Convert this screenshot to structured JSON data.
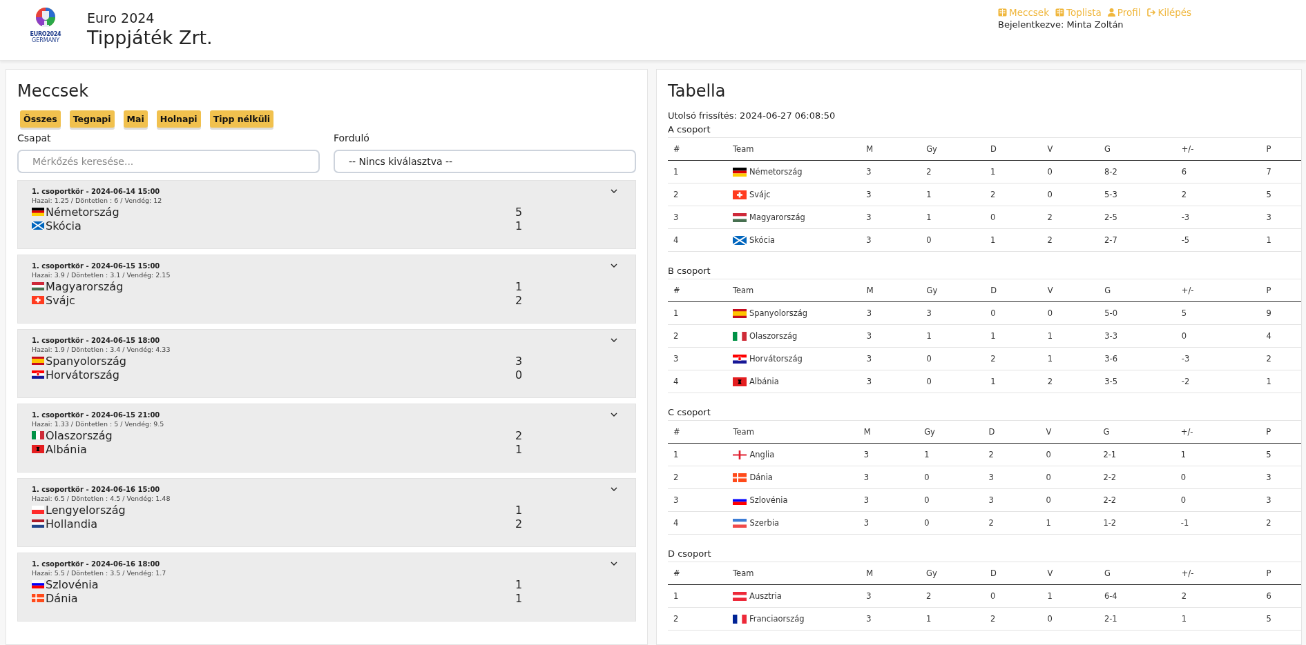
{
  "header": {
    "logo_text": "EURO2024",
    "logo_subtext": "GERMANY",
    "subtitle": "Euro 2024",
    "title": "Tippjáték Zrt.",
    "nav": [
      {
        "kind": "book",
        "label": "Meccsek"
      },
      {
        "kind": "book",
        "label": "Toplista"
      },
      {
        "kind": "user",
        "label": "Profil"
      },
      {
        "kind": "logout",
        "label": "Kilépés"
      }
    ],
    "logged_in": "Bejelentkezve: Minta Zoltán"
  },
  "matches": {
    "title": "Meccsek",
    "filters": [
      "Összes",
      "Tegnapi",
      "Mai",
      "Holnapi",
      "Tipp nélküli"
    ],
    "team_label": "Csapat",
    "team_placeholder": "Mérkőzés keresése...",
    "round_label": "Forduló",
    "round_value": "-- Nincs kiválasztva --",
    "items": [
      {
        "info": "1. csoportkör - 2024-06-14 15:00",
        "odds": "Hazai: 1.25 / Döntetlen : 6 / Vendég: 12",
        "home": {
          "name": "Németország",
          "kind": "de",
          "score": "5"
        },
        "away": {
          "name": "Skócia",
          "kind": "sco",
          "score": "1"
        }
      },
      {
        "info": "1. csoportkör - 2024-06-15 15:00",
        "odds": "Hazai: 3.9 / Döntetlen : 3.1 / Vendég: 2.15",
        "home": {
          "name": "Magyarország",
          "kind": "hu",
          "score": "1"
        },
        "away": {
          "name": "Svájc",
          "kind": "ch",
          "score": "2"
        }
      },
      {
        "info": "1. csoportkör - 2024-06-15 18:00",
        "odds": "Hazai: 1.9 / Döntetlen : 3.4 / Vendég: 4.33",
        "home": {
          "name": "Spanyolország",
          "kind": "es",
          "score": "3"
        },
        "away": {
          "name": "Horvátország",
          "kind": "hr",
          "score": "0"
        }
      },
      {
        "info": "1. csoportkör - 2024-06-15 21:00",
        "odds": "Hazai: 1.33 / Döntetlen : 5 / Vendég: 9.5",
        "home": {
          "name": "Olaszország",
          "kind": "it",
          "score": "2"
        },
        "away": {
          "name": "Albánia",
          "kind": "al",
          "score": "1"
        }
      },
      {
        "info": "1. csoportkör - 2024-06-16 15:00",
        "odds": "Hazai: 6.5 / Döntetlen : 4.5 / Vendég: 1.48",
        "home": {
          "name": "Lengyelország",
          "kind": "pl",
          "score": "1"
        },
        "away": {
          "name": "Hollandia",
          "kind": "nl",
          "score": "2"
        }
      },
      {
        "info": "1. csoportkör - 2024-06-16 18:00",
        "odds": "Hazai: 5.5 / Döntetlen : 3.5 / Vendég: 1.7",
        "home": {
          "name": "Szlovénia",
          "kind": "si",
          "score": "1"
        },
        "away": {
          "name": "Dánia",
          "kind": "dk",
          "score": "1"
        }
      }
    ]
  },
  "standings": {
    "title": "Tabella",
    "updated": "Utolsó frissítés: 2024-06-27 06:08:50",
    "groups": [
      {
        "name": "A csoport",
        "columns": [
          "#",
          "Team",
          "M",
          "Gy",
          "D",
          "V",
          "G",
          "+/-",
          "P"
        ],
        "rows": [
          {
            "kind": "de",
            "cells": [
              "1",
              "Németország",
              "3",
              "2",
              "1",
              "0",
              "8-2",
              "6",
              "7"
            ]
          },
          {
            "kind": "ch",
            "cells": [
              "2",
              "Svájc",
              "3",
              "1",
              "2",
              "0",
              "5-3",
              "2",
              "5"
            ]
          },
          {
            "kind": "hu",
            "cells": [
              "3",
              "Magyarország",
              "3",
              "1",
              "0",
              "2",
              "2-5",
              "-3",
              "3"
            ]
          },
          {
            "kind": "sco",
            "cells": [
              "4",
              "Skócia",
              "3",
              "0",
              "1",
              "2",
              "2-7",
              "-5",
              "1"
            ]
          }
        ]
      },
      {
        "name": "B csoport",
        "columns": [
          "#",
          "Team",
          "M",
          "Gy",
          "D",
          "V",
          "G",
          "+/-",
          "P"
        ],
        "rows": [
          {
            "kind": "es",
            "cells": [
              "1",
              "Spanyolország",
              "3",
              "3",
              "0",
              "0",
              "5-0",
              "5",
              "9"
            ]
          },
          {
            "kind": "it",
            "cells": [
              "2",
              "Olaszország",
              "3",
              "1",
              "1",
              "1",
              "3-3",
              "0",
              "4"
            ]
          },
          {
            "kind": "hr",
            "cells": [
              "3",
              "Horvátország",
              "3",
              "0",
              "2",
              "1",
              "3-6",
              "-3",
              "2"
            ]
          },
          {
            "kind": "al",
            "cells": [
              "4",
              "Albánia",
              "3",
              "0",
              "1",
              "2",
              "3-5",
              "-2",
              "1"
            ]
          }
        ]
      },
      {
        "name": "C csoport",
        "columns": [
          "#",
          "Team",
          "M",
          "Gy",
          "D",
          "V",
          "G",
          "+/-",
          "P"
        ],
        "rows": [
          {
            "kind": "en",
            "cells": [
              "1",
              "Anglia",
              "3",
              "1",
              "2",
              "0",
              "2-1",
              "1",
              "5"
            ]
          },
          {
            "kind": "dk",
            "cells": [
              "2",
              "Dánia",
              "3",
              "0",
              "3",
              "0",
              "2-2",
              "0",
              "3"
            ]
          },
          {
            "kind": "si",
            "cells": [
              "3",
              "Szlovénia",
              "3",
              "0",
              "3",
              "0",
              "2-2",
              "0",
              "3"
            ]
          },
          {
            "kind": "rs",
            "cells": [
              "4",
              "Szerbia",
              "3",
              "0",
              "2",
              "1",
              "1-2",
              "-1",
              "2"
            ]
          }
        ]
      },
      {
        "name": "D csoport",
        "columns": [
          "#",
          "Team",
          "M",
          "Gy",
          "D",
          "V",
          "G",
          "+/-",
          "P"
        ],
        "rows": [
          {
            "kind": "at",
            "cells": [
              "1",
              "Ausztria",
              "3",
              "2",
              "0",
              "1",
              "6-4",
              "2",
              "6"
            ]
          },
          {
            "kind": "fr",
            "cells": [
              "2",
              "Franciaország",
              "3",
              "1",
              "2",
              "0",
              "2-1",
              "1",
              "5"
            ]
          }
        ]
      }
    ]
  }
}
